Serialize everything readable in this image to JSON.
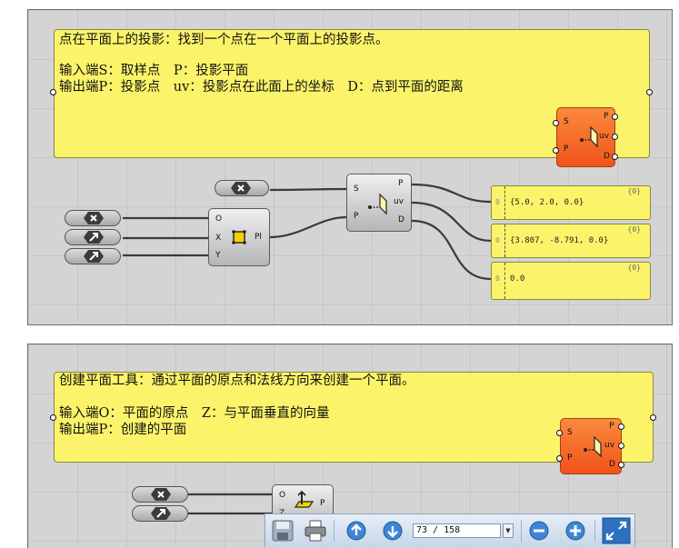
{
  "panel1": {
    "line1": "点在平面上的投影：找到一个点在一个平面上的投影点。",
    "line2": "输入端S：取样点　P：投影平面",
    "line3": "输出端P：投影点　uv：投影点在此面上的坐标　D：点到平面的距离"
  },
  "panel2": {
    "line1": "创建平面工具：通过平面的原点和法线方向来创建一个平面。",
    "line2": "输入端O：平面的原点　Z：与平面垂直的向量",
    "line3": "输出端P：创建的平面"
  },
  "icon_component1": {
    "inputs": [
      "S",
      "P"
    ],
    "outputs": [
      "P",
      "uv",
      "D"
    ]
  },
  "icon_component2": {
    "inputs": [
      "S",
      "P"
    ],
    "outputs": [
      "P",
      "uv",
      "D"
    ]
  },
  "project_component": {
    "inputs": [
      "S",
      "P"
    ],
    "outputs": [
      "P",
      "uv",
      "D"
    ]
  },
  "plane_component": {
    "inputs": [
      "O",
      "X",
      "Y"
    ],
    "output": "Pl"
  },
  "plane_normal_component": {
    "inputs": [
      "O",
      "Z"
    ],
    "output": "P"
  },
  "value_panels": [
    {
      "path": "{0}",
      "index": "0",
      "value": "{5.0, 2.0, 0.0}"
    },
    {
      "path": "{0}",
      "index": "0",
      "value": "{3.807, -8.791, 0.0}"
    },
    {
      "path": "{0}",
      "index": "0",
      "value": "0.0"
    }
  ],
  "toolbar": {
    "page_value": "73 / 158",
    "icons": [
      "save-icon",
      "print-icon",
      "page-up-icon",
      "page-down-icon",
      "zoom-out-icon",
      "zoom-in-icon",
      "fit-page-icon"
    ]
  },
  "colors": {
    "panel_yellow": "#fbf46a",
    "component_orange": "#f0531b",
    "canvas_gray": "#d4d4d4",
    "toolbar_blue": "#c7d6e8"
  }
}
